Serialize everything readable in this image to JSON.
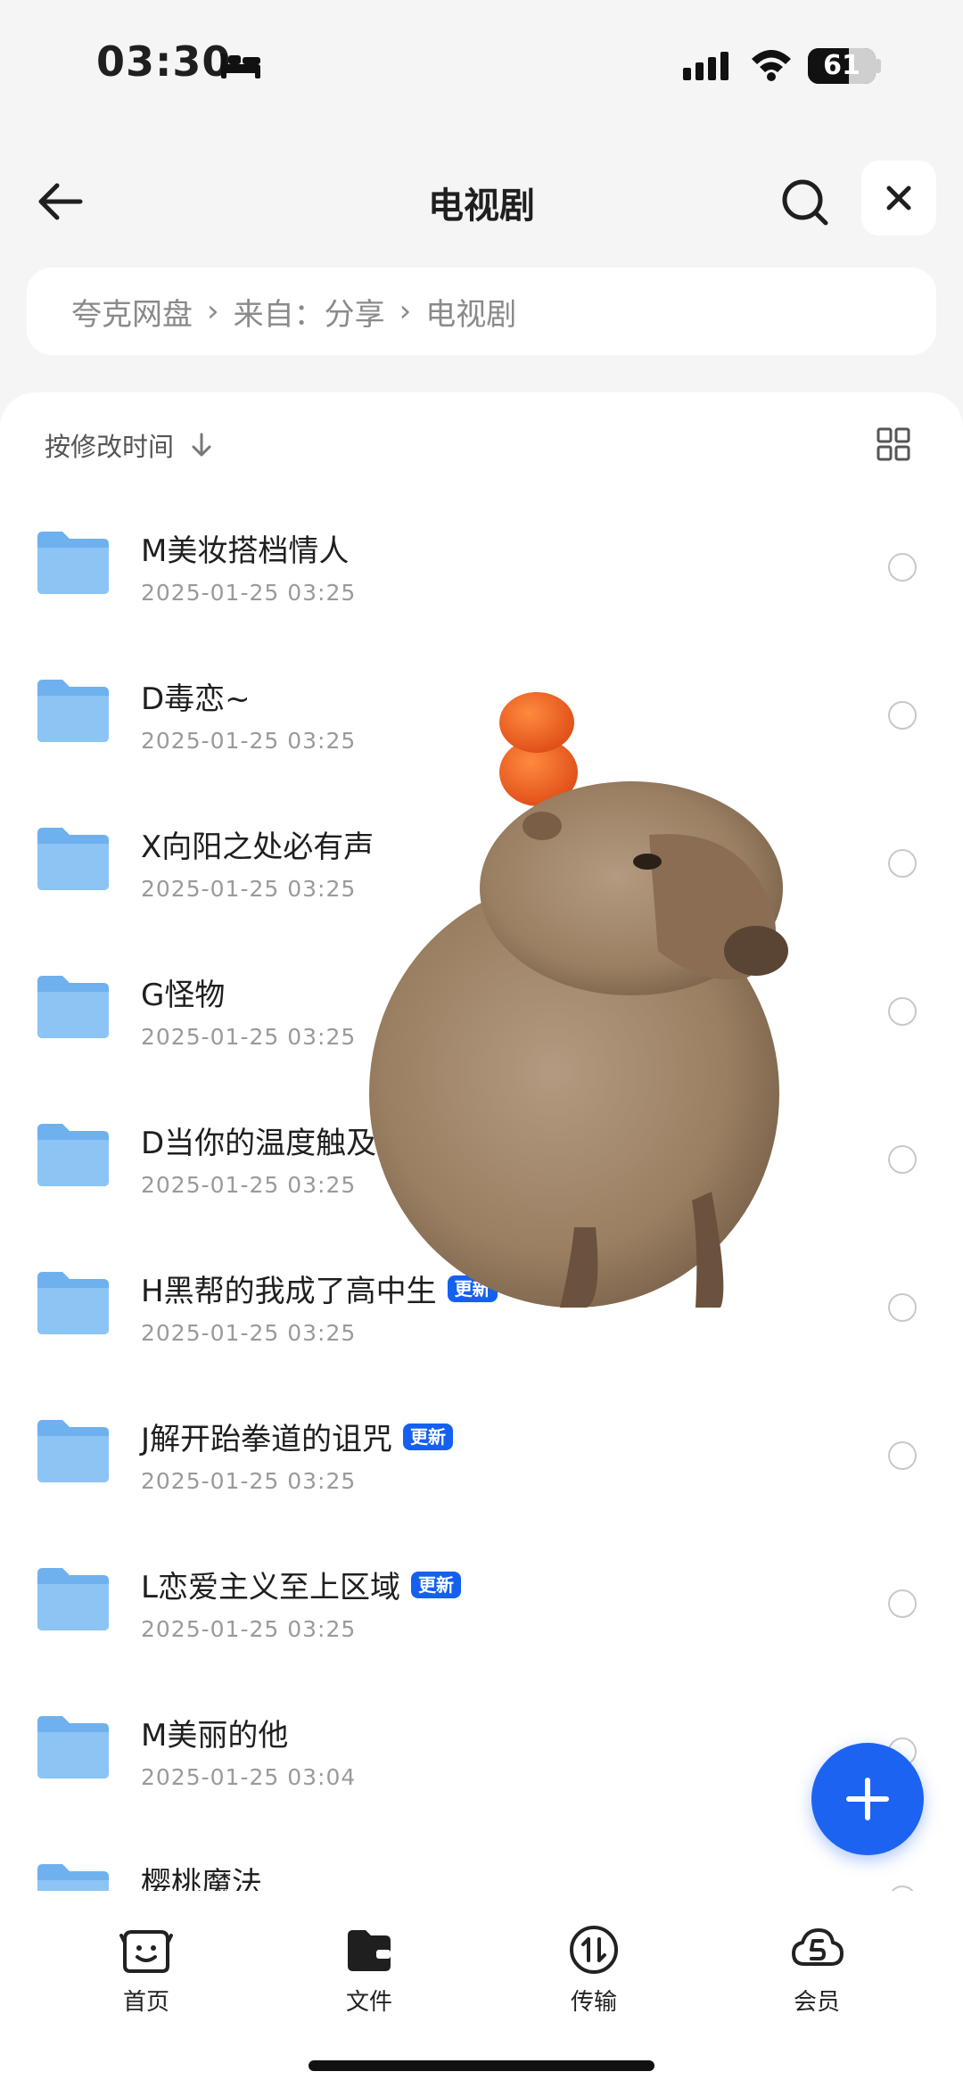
{
  "status": {
    "time": "03:30",
    "battery": "61",
    "battery_level": 0.61
  },
  "nav": {
    "title": "电视剧"
  },
  "breadcrumb": [
    "夸克网盘",
    "来自：分享",
    "电视剧"
  ],
  "sort": {
    "label": "按修改时间"
  },
  "files": [
    {
      "name": "M美妆搭档情人",
      "date": "2025-01-25 03:25",
      "badge": ""
    },
    {
      "name": "D毒恋~",
      "date": "2025-01-25 03:25",
      "badge": ""
    },
    {
      "name": "X向阳之处必有声",
      "date": "2025-01-25 03:25",
      "badge": ""
    },
    {
      "name": "G怪物",
      "date": "2025-01-25 03:25",
      "badge": ""
    },
    {
      "name": "D当你的温度触及",
      "date": "2025-01-25 03:25",
      "badge": ""
    },
    {
      "name": "H黑帮的我成了高中生",
      "date": "2025-01-25 03:25",
      "badge": "更新"
    },
    {
      "name": "J解开跆拳道的诅咒",
      "date": "2025-01-25 03:25",
      "badge": "更新"
    },
    {
      "name": "L恋爱主义至上区域",
      "date": "2025-01-25 03:25",
      "badge": "更新"
    },
    {
      "name": "M美丽的他",
      "date": "2025-01-25 03:04",
      "badge": ""
    },
    {
      "name": "樱桃魔法",
      "date": "",
      "badge": ""
    }
  ],
  "tabs": [
    {
      "label": "首页",
      "icon": "home-face-icon"
    },
    {
      "label": "文件",
      "icon": "folder-file-icon"
    },
    {
      "label": "传输",
      "icon": "transfer-icon"
    },
    {
      "label": "会员",
      "icon": "member-cloud-icon"
    }
  ],
  "colors": {
    "accent": "#1d63f2",
    "badge": "#1560f0",
    "folder": "#7fb8f0"
  }
}
